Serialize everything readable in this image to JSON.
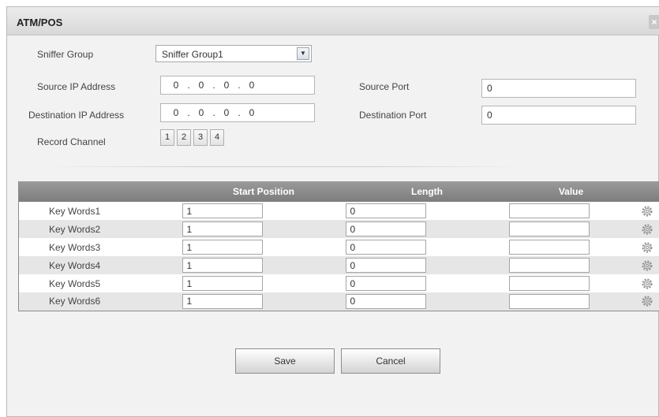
{
  "dialog": {
    "title": "ATM/POS",
    "close_glyph": "×"
  },
  "form": {
    "sniffer_group": {
      "label": "Sniffer Group",
      "value": "Sniffer Group1"
    },
    "source_ip": {
      "label": "Source IP Address",
      "octets": [
        "0",
        "0",
        "0",
        "0"
      ]
    },
    "destination_ip": {
      "label": "Destination IP Address",
      "octets": [
        "0",
        "0",
        "0",
        "0"
      ]
    },
    "source_port": {
      "label": "Source Port",
      "value": "0"
    },
    "destination_port": {
      "label": "Destination Port",
      "value": "0"
    },
    "record_channel": {
      "label": "Record Channel",
      "channels": [
        "1",
        "2",
        "3",
        "4"
      ]
    }
  },
  "table": {
    "headers": [
      "",
      "Start Position",
      "Length",
      "Value",
      ""
    ],
    "rows": [
      {
        "name": "Key Words1",
        "start": "1",
        "length": "0",
        "value": ""
      },
      {
        "name": "Key Words2",
        "start": "1",
        "length": "0",
        "value": ""
      },
      {
        "name": "Key Words3",
        "start": "1",
        "length": "0",
        "value": ""
      },
      {
        "name": "Key Words4",
        "start": "1",
        "length": "0",
        "value": ""
      },
      {
        "name": "Key Words5",
        "start": "1",
        "length": "0",
        "value": ""
      },
      {
        "name": "Key Words6",
        "start": "1",
        "length": "0",
        "value": ""
      }
    ]
  },
  "buttons": {
    "save": "Save",
    "cancel": "Cancel"
  },
  "icons": {
    "row_settings": "gear-icon",
    "dropdown": "chevron-down-icon",
    "close": "close-icon"
  }
}
